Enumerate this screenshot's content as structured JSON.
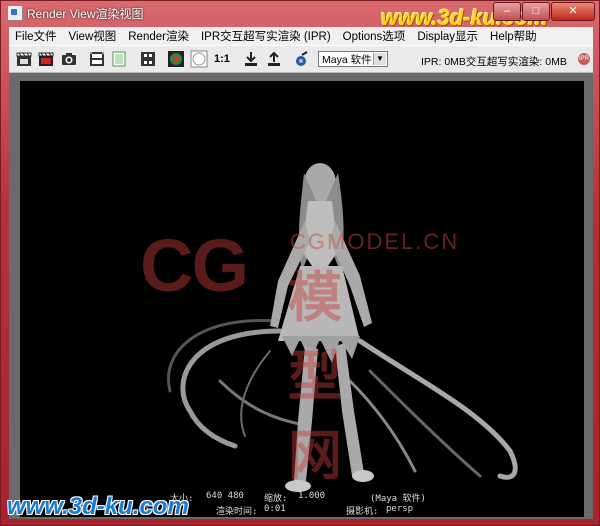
{
  "window": {
    "title": "Render View渲染视图",
    "buttons": [
      "0",
      "1",
      "r"
    ]
  },
  "watermarks": {
    "top": "www.3d-ku.com",
    "bottom": "www.3d-ku.com",
    "center_brand": "CG",
    "center_domain": "CGMODEL.CN",
    "center_chinese": "模型网"
  },
  "menu": {
    "items": [
      {
        "label": "File文件"
      },
      {
        "label": "View视图"
      },
      {
        "label": "Render渲染"
      },
      {
        "label": "IPR交互超写实渲染 (IPR)"
      },
      {
        "label": "Options选项"
      },
      {
        "label": "Display显示"
      },
      {
        "label": "Help帮助"
      }
    ]
  },
  "toolbar": {
    "ratio_label": "1:1",
    "renderer": "Maya 软件",
    "ipr_status": "IPR: 0MB交互超写实渲染: 0MB",
    "ipr_icon_text": "IPR"
  },
  "render_info": {
    "size_label": "大小:",
    "size_value": "640  480",
    "zoom_label": "缩放:",
    "zoom_value": "1.000",
    "renderer": "(Maya 软件)",
    "frame_partial": "1",
    "time_label": "渲染时间:",
    "time_value": "0:01",
    "camera_label": "摄影机:",
    "camera_value": "persp"
  },
  "colors": {
    "title_bar": "#b4303a",
    "viewport_bg": "#000000",
    "frame_bg": "#6a6a6a"
  }
}
